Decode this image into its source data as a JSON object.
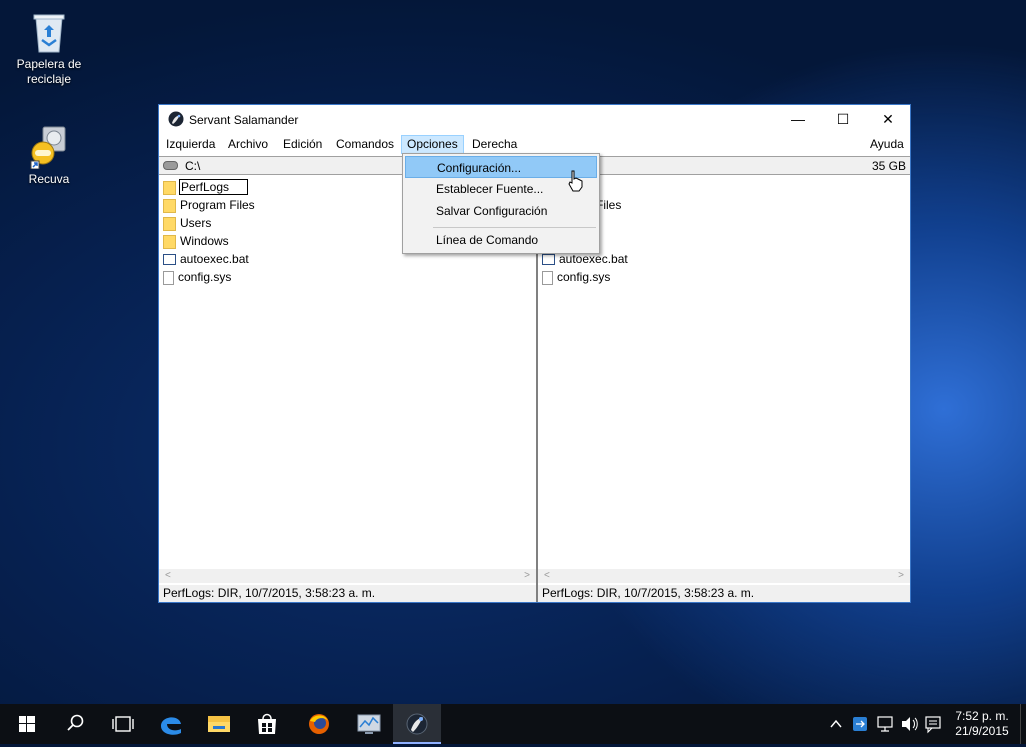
{
  "desktop": {
    "icons": [
      {
        "label": "Papelera de reciclaje",
        "icon": "recycle-bin-icon"
      },
      {
        "label": "Recuva",
        "icon": "recuva-icon"
      }
    ]
  },
  "window": {
    "title": "Servant Salamander",
    "controls": {
      "minimize": "—",
      "maximize": "☐",
      "close": "✕"
    },
    "menu": [
      "Izquierda",
      "Archivo",
      "Edición",
      "Comandos",
      "Opciones",
      "Derecha"
    ],
    "menu_right": "Ayuda",
    "active_menu": "Opciones",
    "left_panel": {
      "path": "C:\\",
      "files": [
        {
          "name": "PerfLogs",
          "type": "folder"
        },
        {
          "name": "Program Files",
          "type": "folder"
        },
        {
          "name": "Users",
          "type": "folder"
        },
        {
          "name": "Windows",
          "type": "folder"
        },
        {
          "name": "autoexec.bat",
          "type": "bat"
        },
        {
          "name": "config.sys",
          "type": "sys"
        }
      ],
      "status": "PerfLogs: DIR, 10/7/2015, 3:58:23 a. m."
    },
    "right_panel": {
      "free_space": "35 GB",
      "files": [
        {
          "name": "Files",
          "type": "folder-partial"
        },
        {
          "name": "autoexec.bat",
          "type": "bat"
        },
        {
          "name": "config.sys",
          "type": "sys"
        }
      ],
      "status": "PerfLogs: DIR, 10/7/2015, 3:58:23 a. m."
    },
    "dropdown": {
      "items": [
        "Configuración...",
        "Establecer Fuente...",
        "Salvar Configuración",
        "Línea de Comando"
      ],
      "highlighted": "Configuración..."
    }
  },
  "taskbar": {
    "buttons": [
      "windows-start-icon",
      "search-icon",
      "task-view-icon",
      "edge-icon",
      "file-explorer-icon",
      "store-icon",
      "firefox-icon",
      "monitor-app-icon",
      "salamander-icon"
    ],
    "clock": {
      "time": "7:52 p. m.",
      "date": "21/9/2015"
    }
  }
}
